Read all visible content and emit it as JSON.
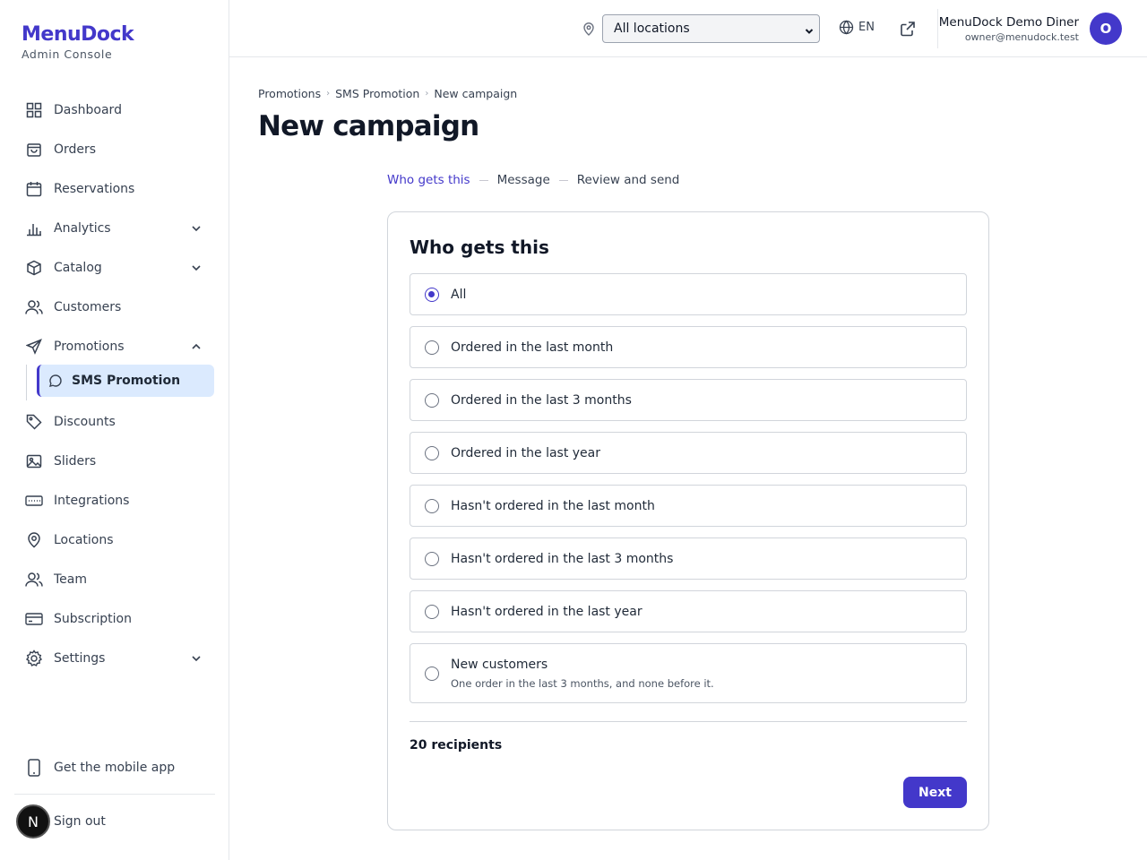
{
  "brand": {
    "title": "MenuDock",
    "subtitle": "Admin Console"
  },
  "sidebar": {
    "items": [
      {
        "label": "Dashboard",
        "icon": "grid-icon"
      },
      {
        "label": "Orders",
        "icon": "bag-icon"
      },
      {
        "label": "Reservations",
        "icon": "calendar-icon"
      },
      {
        "label": "Analytics",
        "icon": "bar-chart-icon",
        "expandable": true
      },
      {
        "label": "Catalog",
        "icon": "box-icon",
        "expandable": true
      },
      {
        "label": "Customers",
        "icon": "users-icon"
      },
      {
        "label": "Promotions",
        "icon": "send-icon",
        "expanded": true
      },
      {
        "label": "Discounts",
        "icon": "tag-icon"
      },
      {
        "label": "Sliders",
        "icon": "image-icon"
      },
      {
        "label": "Integrations",
        "icon": "keyboard-icon"
      },
      {
        "label": "Locations",
        "icon": "map-pin-icon"
      },
      {
        "label": "Team",
        "icon": "team-icon"
      },
      {
        "label": "Subscription",
        "icon": "credit-card-icon"
      },
      {
        "label": "Settings",
        "icon": "gear-icon",
        "expandable": true
      }
    ],
    "sub_item": {
      "label": "SMS Promotion",
      "icon": "message-icon"
    },
    "mobile_app": "Get the mobile app",
    "sign_out": "Sign out",
    "sign_out_badge": "N"
  },
  "topbar": {
    "location_select": "All locations",
    "language": "EN",
    "user_name": "MenuDock Demo Diner",
    "user_email": "owner@menudock.test",
    "avatar_letter": "O"
  },
  "breadcrumb": [
    "Promotions",
    "SMS Promotion",
    "New campaign"
  ],
  "page_title": "New campaign",
  "steps": [
    "Who gets this",
    "Message",
    "Review and send"
  ],
  "card": {
    "title": "Who gets this",
    "options": [
      {
        "label": "All",
        "checked": true
      },
      {
        "label": "Ordered in the last month"
      },
      {
        "label": "Ordered in the last 3 months"
      },
      {
        "label": "Ordered in the last year"
      },
      {
        "label": "Hasn't ordered in the last month"
      },
      {
        "label": "Hasn't ordered in the last 3 months"
      },
      {
        "label": "Hasn't ordered in the last year"
      },
      {
        "label": "New customers",
        "description": "One order in the last 3 months, and none before it."
      }
    ],
    "recipients": "20 recipients",
    "next_label": "Next"
  },
  "colors": {
    "accent": "#4338ca",
    "active_bg": "#dbeafe"
  }
}
